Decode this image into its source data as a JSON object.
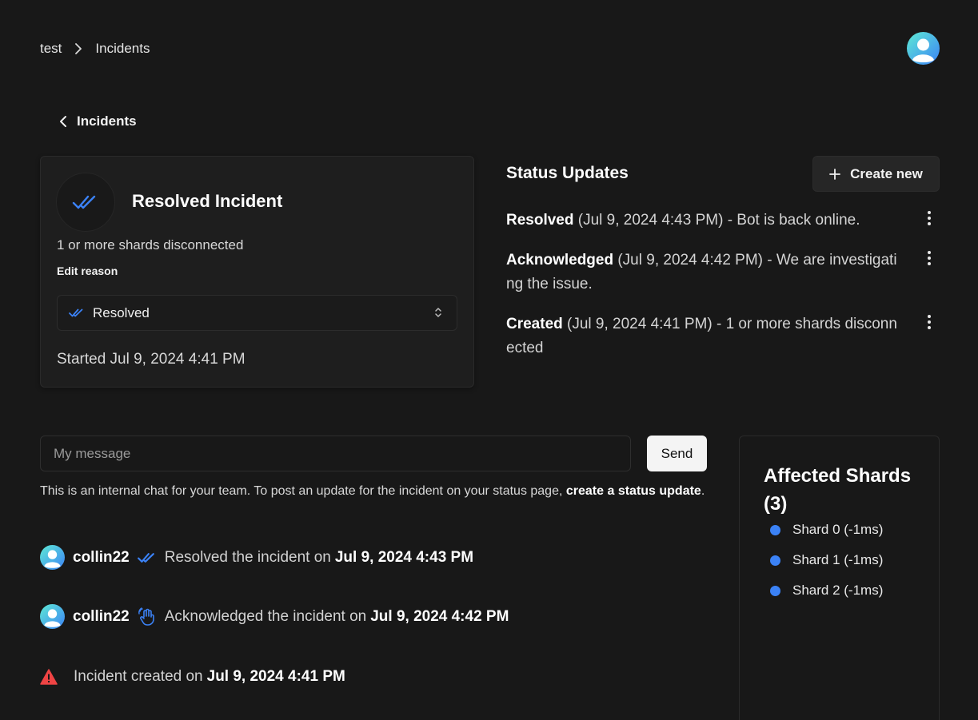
{
  "breadcrumb": {
    "items": [
      "test",
      "Incidents"
    ]
  },
  "back_link": {
    "label": "Incidents"
  },
  "incident": {
    "title": "Resolved Incident",
    "reason": "1 or more shards disconnected",
    "edit_reason_label": "Edit reason",
    "status_select_value": "Resolved",
    "started_text": "Started Jul 9, 2024 4:41 PM"
  },
  "status_updates": {
    "title": "Status Updates",
    "create_label": "Create new",
    "items": [
      {
        "status": "Resolved",
        "text": " (Jul 9, 2024 4:43 PM) - Bot is back online."
      },
      {
        "status": "Acknowledged",
        "text": " (Jul 9, 2024 4:42 PM) - We are investigating the issue."
      },
      {
        "status": "Created",
        "text": " (Jul 9, 2024 4:41 PM) - 1 or more shards disconnected"
      }
    ]
  },
  "chat": {
    "placeholder": "My message",
    "send_label": "Send",
    "info_prefix": "This is an internal chat for your team. To post an update for the incident on your status page, ",
    "info_link": "create a status update",
    "info_suffix": "."
  },
  "activity": [
    {
      "user": "collin22",
      "text": "Resolved the incident on ",
      "date": "Jul 9, 2024 4:43 PM",
      "icon": "double-check-icon"
    },
    {
      "user": "collin22",
      "text": "Acknowledged the incident on ",
      "date": "Jul 9, 2024 4:42 PM",
      "icon": "hand-wave-icon"
    },
    {
      "user": "",
      "text": "Incident created on ",
      "date": "Jul 9, 2024 4:41 PM",
      "icon": "warning-icon"
    }
  ],
  "affected_shards": {
    "title": "Affected Shards (3)",
    "items": [
      "Shard 0 (-1ms)",
      "Shard 1 (-1ms)",
      "Shard 2 (-1ms)"
    ]
  },
  "colors": {
    "background": "#181818",
    "accent_blue": "#3b82f6",
    "warning_red": "#ef4444",
    "dot_blue": "#3b82f6"
  }
}
